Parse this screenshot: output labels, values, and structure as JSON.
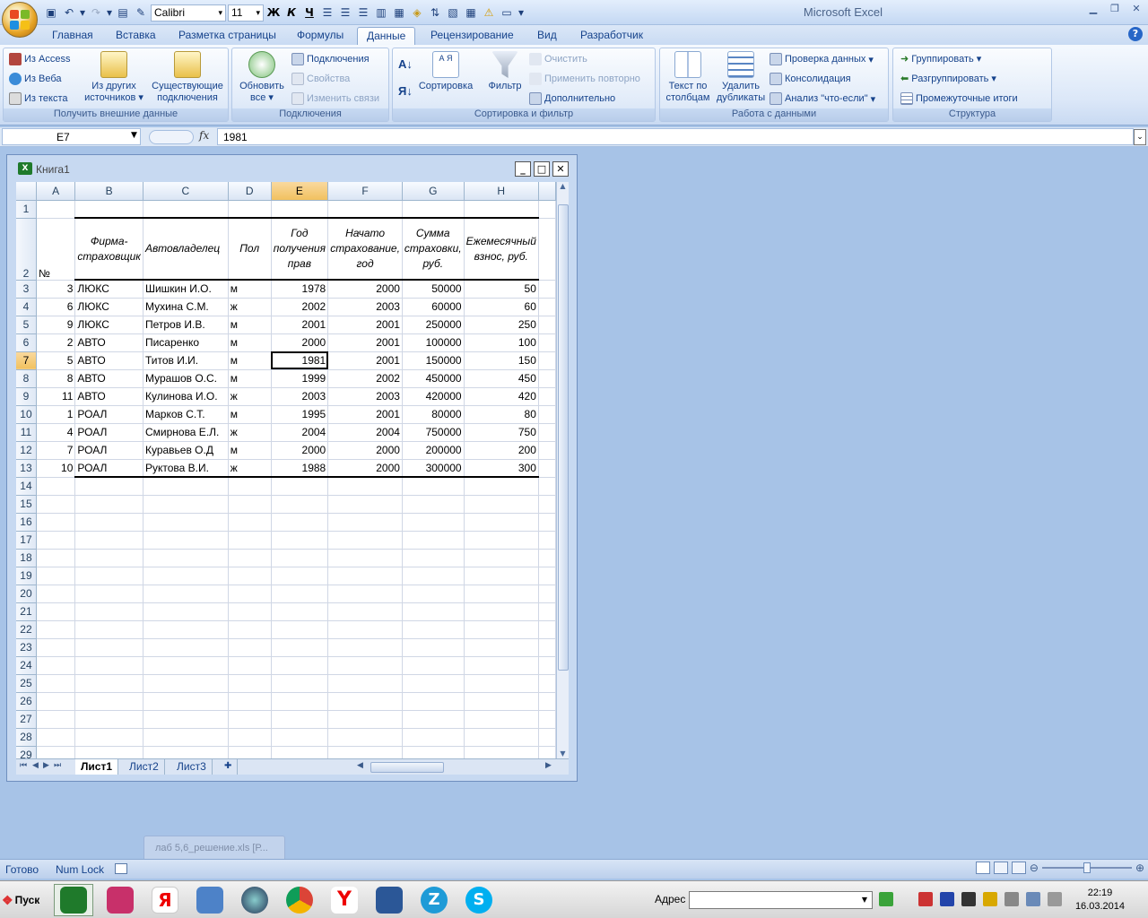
{
  "app": {
    "title": "Microsoft Excel"
  },
  "quick_access": {
    "font_name": "Calibri",
    "font_size": "11",
    "bold": "Ж",
    "italic": "К",
    "underline": "Ч"
  },
  "tabs": [
    "Главная",
    "Вставка",
    "Разметка страницы",
    "Формулы",
    "Данные",
    "Рецензирование",
    "Вид",
    "Разработчик"
  ],
  "active_tab": "Данные",
  "ribbon": {
    "external": {
      "from_access": "Из Access",
      "from_web": "Из Веба",
      "from_text": "Из текста",
      "other_sources_1": "Из других",
      "other_sources_2": "источников",
      "existing_1": "Существующие",
      "existing_2": "подключения",
      "label": "Получить внешние данные"
    },
    "connections": {
      "refresh_1": "Обновить",
      "refresh_2": "все",
      "connections": "Подключения",
      "properties": "Свойства",
      "edit_links": "Изменить связи",
      "label": "Подключения"
    },
    "sort": {
      "sort_az": "А Я",
      "sort": "Сортировка",
      "filter": "Фильтр",
      "clear": "Очистить",
      "reapply": "Применить повторно",
      "advanced": "Дополнительно",
      "label": "Сортировка и фильтр"
    },
    "datatools": {
      "text_to_cols_1": "Текст по",
      "text_to_cols_2": "столбцам",
      "remove_dup_1": "Удалить",
      "remove_dup_2": "дубликаты",
      "validation": "Проверка данных",
      "consolidate": "Консолидация",
      "whatif": "Анализ \"что-если\"",
      "label": "Работа с данными"
    },
    "outline": {
      "group": "Группировать",
      "ungroup": "Разгруппировать",
      "subtotal": "Промежуточные итоги",
      "label": "Структура"
    }
  },
  "formula_bar": {
    "name_box": "E7",
    "fx": "fx",
    "content": "1981"
  },
  "workbook": {
    "title": "Книга1",
    "min": "_",
    "max": "□",
    "close": "✕"
  },
  "columns": [
    "A",
    "B",
    "C",
    "D",
    "E",
    "F",
    "G",
    "H"
  ],
  "header_row": {
    "a": "№",
    "b": "Фирма-страховщик",
    "c": "Автовладелец",
    "d": "Пол",
    "e": "Год получения прав",
    "f": "Начато страхование, год",
    "g": "Сумма страховки, руб.",
    "h": "Ежемесячный взнос, руб."
  },
  "rows": [
    [
      "3",
      "ЛЮКС",
      "Шишкин И.О.",
      "м",
      "1978",
      "2000",
      "50000",
      "50"
    ],
    [
      "6",
      "ЛЮКС",
      "Мухина С.М.",
      "ж",
      "2002",
      "2003",
      "60000",
      "60"
    ],
    [
      "9",
      "ЛЮКС",
      "Петров И.В.",
      "м",
      "2001",
      "2001",
      "250000",
      "250"
    ],
    [
      "2",
      "АВТО",
      "Писаренко",
      "м",
      "2000",
      "2001",
      "100000",
      "100"
    ],
    [
      "5",
      "АВТО",
      "Титов И.И.",
      "м",
      "1981",
      "2001",
      "150000",
      "150"
    ],
    [
      "8",
      "АВТО",
      "Мурашов О.С.",
      "м",
      "1999",
      "2002",
      "450000",
      "450"
    ],
    [
      "11",
      "АВТО",
      "Кулинова И.О.",
      "ж",
      "2003",
      "2003",
      "420000",
      "420"
    ],
    [
      "1",
      "РОАЛ",
      "Марков С.Т.",
      "м",
      "1995",
      "2001",
      "80000",
      "80"
    ],
    [
      "4",
      "РОАЛ",
      "Смирнова Е.Л.",
      "ж",
      "2004",
      "2004",
      "750000",
      "750"
    ],
    [
      "7",
      "РОАЛ",
      "Куравьев О.Д",
      "м",
      "2000",
      "2000",
      "200000",
      "200"
    ],
    [
      "10",
      "РОАЛ",
      "Руктова В.И.",
      "ж",
      "1988",
      "2000",
      "300000",
      "300"
    ]
  ],
  "sheets": [
    "Лист1",
    "Лист2",
    "Лист3"
  ],
  "taskbar_doc": "лаб 5,6_решение.xls  [Р...",
  "status": {
    "ready": "Готово",
    "numlock": "Num Lock"
  },
  "taskbar": {
    "start": "Пуск",
    "address": "Адрес",
    "time": "22:19",
    "date": "16.03.2014"
  }
}
